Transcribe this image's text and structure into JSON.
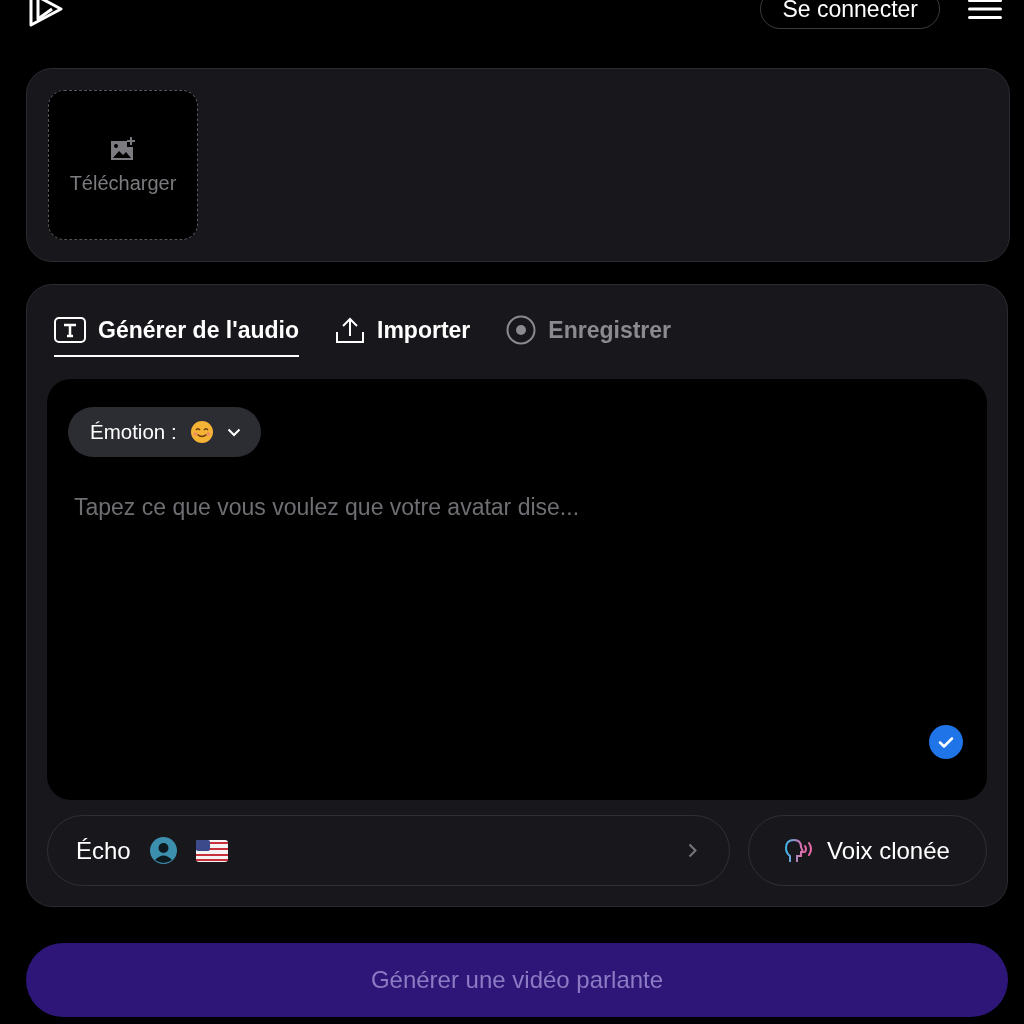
{
  "header": {
    "login_button": "Se connecter"
  },
  "upload": {
    "label": "Télécharger"
  },
  "audio_tabs": [
    {
      "label": "Générer de l'audio",
      "selected": true,
      "disabled": false
    },
    {
      "label": "Importer",
      "selected": false,
      "disabled": false
    },
    {
      "label": "Enregistrer",
      "selected": false,
      "disabled": true
    }
  ],
  "emotion": {
    "label": "Émotion :"
  },
  "script": {
    "placeholder": "Tapez ce que vous voulez que votre avatar dise..."
  },
  "voice": {
    "name": "Écho"
  },
  "clone_button": "Voix clonée",
  "generate_button": {
    "label": "Générer une vidéo parlante",
    "disabled": true
  }
}
